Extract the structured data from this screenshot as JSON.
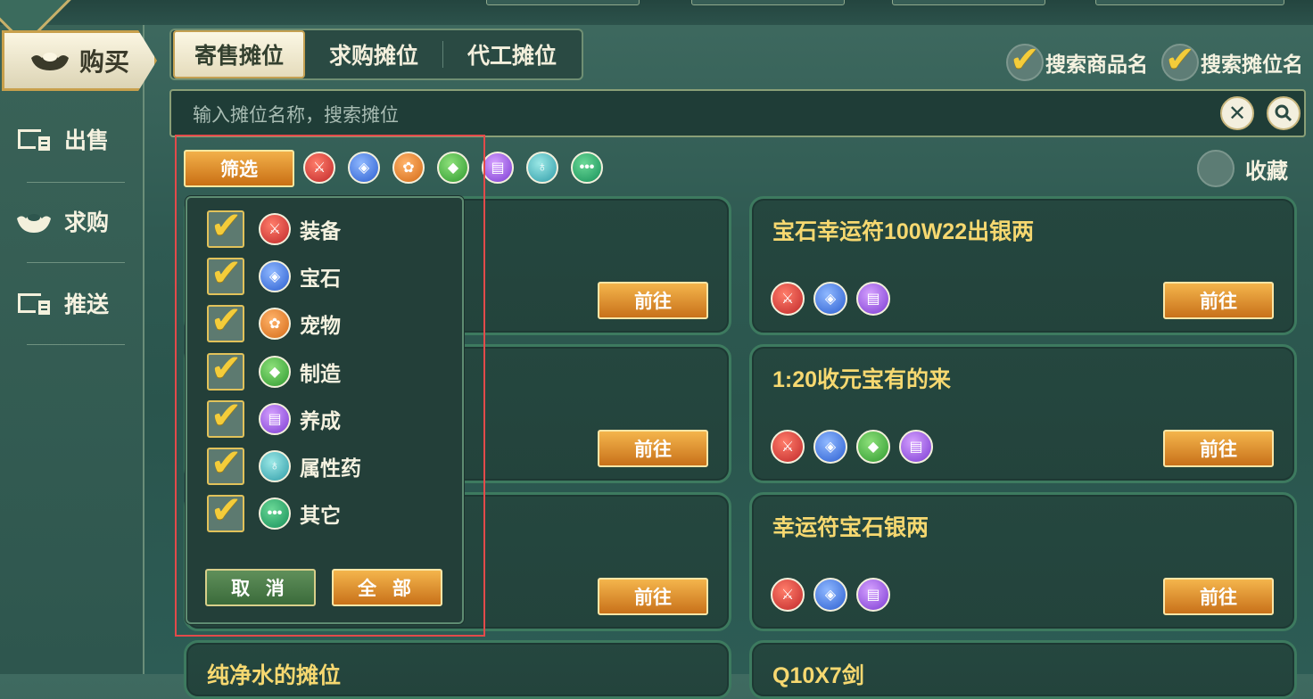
{
  "sidebar": {
    "buy_label": "购买",
    "items": [
      {
        "label": "出售",
        "icon": "stall-board-icon"
      },
      {
        "label": "求购",
        "icon": "ingot-icon"
      },
      {
        "label": "推送",
        "icon": "stall-board-icon"
      }
    ]
  },
  "tabs": [
    {
      "label": "寄售摊位",
      "active": true
    },
    {
      "label": "求购摊位",
      "active": false
    },
    {
      "label": "代工摊位",
      "active": false
    }
  ],
  "search_options": [
    {
      "label": "搜索商品名",
      "checked": true
    },
    {
      "label": "搜索摊位名",
      "checked": true
    }
  ],
  "search": {
    "placeholder": "输入摊位名称，搜索摊位"
  },
  "filter": {
    "button_label": "筛选",
    "favorite_label": "收藏"
  },
  "categories": [
    {
      "label": "装备",
      "icon": "equipment-icon",
      "checked": true
    },
    {
      "label": "宝石",
      "icon": "gem-icon",
      "checked": true
    },
    {
      "label": "宠物",
      "icon": "pet-icon",
      "checked": true
    },
    {
      "label": "制造",
      "icon": "craft-icon",
      "checked": true
    },
    {
      "label": "养成",
      "icon": "scroll-icon",
      "checked": true
    },
    {
      "label": "属性药",
      "icon": "potion-icon",
      "checked": true
    },
    {
      "label": "其它",
      "icon": "other-icon",
      "checked": true
    }
  ],
  "dropdown": {
    "cancel_label": "取 消",
    "all_label": "全 部"
  },
  "go_label": "前往",
  "stalls_right": [
    {
      "title": "宝石幸运符100W22出银两",
      "icons": [
        "equipment-icon",
        "gem-icon",
        "scroll-icon"
      ]
    },
    {
      "title": "1:20收元宝有的来",
      "icons": [
        "equipment-icon",
        "gem-icon",
        "craft-icon",
        "scroll-icon"
      ]
    },
    {
      "title": "幸运符宝石银两",
      "icons": [
        "equipment-icon",
        "gem-icon",
        "scroll-icon"
      ]
    },
    {
      "title": "Q10X7剑",
      "icons": []
    }
  ],
  "stalls_left": [
    {
      "title": ""
    },
    {
      "title": ""
    },
    {
      "title": ""
    },
    {
      "title": "纯净水的摊位"
    }
  ]
}
